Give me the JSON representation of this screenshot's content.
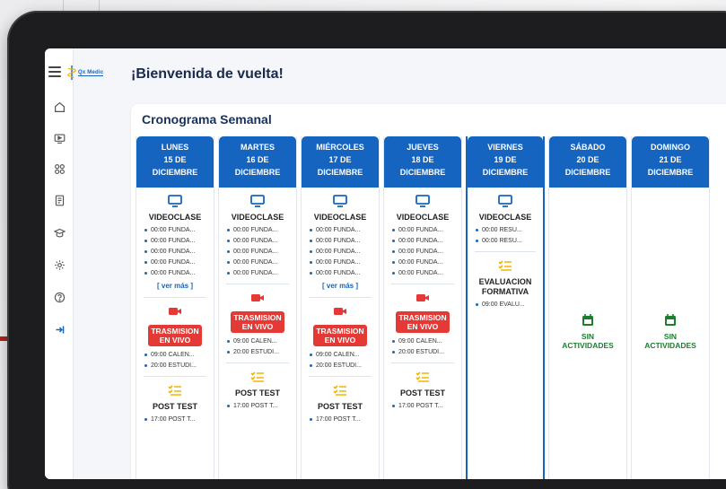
{
  "app": {
    "logo_text": "Qx Medic",
    "welcome": "¡Bienvenida de vuelta!"
  },
  "sidebar": {
    "items": [
      {
        "icon": "home-icon"
      },
      {
        "icon": "video-icon"
      },
      {
        "icon": "grid-icon"
      },
      {
        "icon": "document-icon"
      },
      {
        "icon": "graduation-icon"
      },
      {
        "icon": "settings-icon"
      },
      {
        "icon": "help-icon"
      },
      {
        "icon": "logout-icon"
      }
    ]
  },
  "schedule": {
    "title": "Cronograma Semanal",
    "days": [
      {
        "name": "LUNES",
        "date": "15 DE",
        "month": "DICIEMBRE",
        "videoclase": {
          "title": "VIDEOCLASE",
          "items": [
            "00:00 FUNDA...",
            "00:00 FUNDA...",
            "00:00 FUNDA...",
            "00:00 FUNDA...",
            "00:00 FUNDA..."
          ],
          "more": "[ ver más ]"
        },
        "live": {
          "title_1": "TRASMISION",
          "title_2": "EN VIVO",
          "items": [
            "09:00 CALEN...",
            "20:00 ESTUDI..."
          ]
        },
        "test": {
          "title": "POST TEST",
          "items": [
            "17:00 POST T..."
          ]
        }
      },
      {
        "name": "MARTES",
        "date": "16 DE",
        "month": "DICIEMBRE",
        "videoclase": {
          "title": "VIDEOCLASE",
          "items": [
            "00:00 FUNDA...",
            "00:00 FUNDA...",
            "00:00 FUNDA...",
            "00:00 FUNDA...",
            "00:00 FUNDA..."
          ]
        },
        "live": {
          "title_1": "TRASMISION",
          "title_2": "EN VIVO",
          "items": [
            "09:00 CALEN...",
            "20:00 ESTUDI..."
          ]
        },
        "test": {
          "title": "POST TEST",
          "items": [
            "17:00 POST T..."
          ]
        }
      },
      {
        "name": "MIÉRCOLES",
        "date": "17 DE",
        "month": "DICIEMBRE",
        "videoclase": {
          "title": "VIDEOCLASE",
          "items": [
            "00:00 FUNDA...",
            "00:00 FUNDA...",
            "00:00 FUNDA...",
            "00:00 FUNDA...",
            "00:00 FUNDA..."
          ],
          "more": "[ ver más ]"
        },
        "live": {
          "title_1": "TRASMISION",
          "title_2": "EN VIVO",
          "items": [
            "09:00 CALEN...",
            "20:00 ESTUDI..."
          ]
        },
        "test": {
          "title": "POST TEST",
          "items": [
            "17:00 POST T..."
          ]
        }
      },
      {
        "name": "JUEVES",
        "date": "18 DE",
        "month": "DICIEMBRE",
        "videoclase": {
          "title": "VIDEOCLASE",
          "items": [
            "00:00 FUNDA...",
            "00:00 FUNDA...",
            "00:00 FUNDA...",
            "00:00 FUNDA...",
            "00:00 FUNDA..."
          ]
        },
        "live": {
          "title_1": "TRASMISION",
          "title_2": "EN VIVO",
          "items": [
            "09:00 CALEN...",
            "20:00 ESTUDI..."
          ]
        },
        "test": {
          "title": "POST TEST",
          "items": [
            "17:00 POST T..."
          ]
        }
      },
      {
        "name": "VIERNES",
        "date": "19 DE",
        "month": "DICIEMBRE",
        "videoclase": {
          "title": "VIDEOCLASE",
          "items": [
            "00:00 RESU...",
            "00:00 RESU..."
          ]
        },
        "eval": {
          "title_1": "EVALUACION",
          "title_2": "FORMATIVA",
          "items": [
            "09:00 EVALU..."
          ]
        }
      },
      {
        "name": "SÁBADO",
        "date": "20 DE",
        "month": "DICIEMBRE",
        "empty": {
          "line_1": "SIN",
          "line_2": "ACTIVIDADES"
        }
      },
      {
        "name": "DOMINGO",
        "date": "21 DE",
        "month": "DICIEMBRE",
        "empty": {
          "line_1": "SIN",
          "line_2": "ACTIVIDADES"
        }
      }
    ]
  },
  "colors": {
    "primary": "#1565c0",
    "live": "#e53935",
    "test": "#f5b400",
    "empty": "#1b7f2e"
  }
}
